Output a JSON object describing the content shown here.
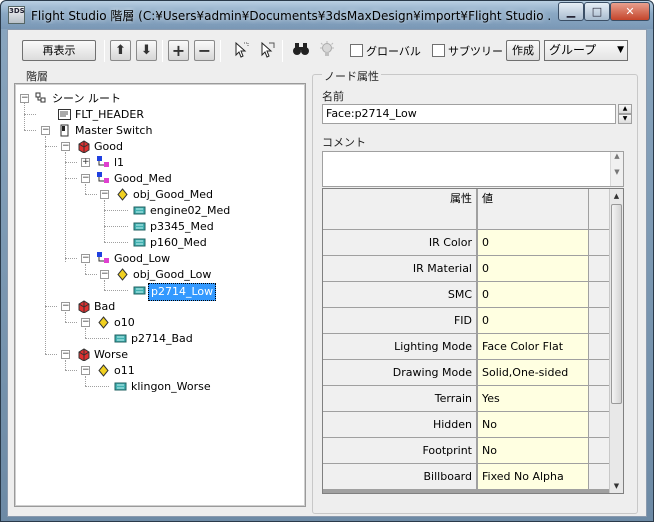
{
  "window": {
    "title": "Flight Studio 階層 (C:¥Users¥admin¥Documents¥3dsMaxDesign¥import¥Flight Studio ...",
    "app_icon_text": "3DS",
    "minimize_glyph": "▁",
    "maximize_glyph": "□",
    "close_glyph": "✕"
  },
  "toolbar": {
    "refresh_label": "再表示",
    "global_label": "グローバル",
    "subtree_label": "サブツリー",
    "create_label": "作成",
    "group_select": "グループ",
    "icons": [
      "arrow-up-icon",
      "arrow-down-icon",
      "plus-icon",
      "minus-icon",
      "select-cursor-icon",
      "select-cursor-alt-icon",
      "binoculars-icon",
      "lightbulb-icon"
    ]
  },
  "hierarchy": {
    "label": "階層",
    "nodes": [
      {
        "label": "シーン ルート",
        "icon": "scene-root-icon",
        "level": 0,
        "expander": "−"
      },
      {
        "label": "FLT_HEADER",
        "icon": "header-icon",
        "level": 1,
        "expander": ""
      },
      {
        "label": "Master Switch",
        "icon": "switch-icon",
        "level": 1,
        "expander": "−"
      },
      {
        "label": "Good",
        "icon": "lod-icon",
        "level": 2,
        "expander": "−"
      },
      {
        "label": "l1",
        "icon": "group-icon",
        "level": 3,
        "expander": "+"
      },
      {
        "label": "Good_Med",
        "icon": "group-icon",
        "level": 3,
        "expander": "−"
      },
      {
        "label": "obj_Good_Med",
        "icon": "object-icon",
        "level": 4,
        "expander": "−"
      },
      {
        "label": "engine02_Med",
        "icon": "face-icon",
        "level": 5,
        "expander": ""
      },
      {
        "label": "p3345_Med",
        "icon": "face-icon",
        "level": 5,
        "expander": ""
      },
      {
        "label": "p160_Med",
        "icon": "face-icon",
        "level": 5,
        "expander": ""
      },
      {
        "label": "Good_Low",
        "icon": "group-icon",
        "level": 3,
        "expander": "−"
      },
      {
        "label": "obj_Good_Low",
        "icon": "object-icon",
        "level": 4,
        "expander": "−"
      },
      {
        "label": "p2714_Low",
        "icon": "face-icon",
        "level": 5,
        "expander": "",
        "selected": true
      },
      {
        "label": "Bad",
        "icon": "lod-icon",
        "level": 2,
        "expander": "−"
      },
      {
        "label": "o10",
        "icon": "object-icon",
        "level": 3,
        "expander": "−"
      },
      {
        "label": "p2714_Bad",
        "icon": "face-icon",
        "level": 4,
        "expander": ""
      },
      {
        "label": "Worse",
        "icon": "lod-icon",
        "level": 2,
        "expander": "−"
      },
      {
        "label": "o11",
        "icon": "object-icon",
        "level": 3,
        "expander": "−"
      },
      {
        "label": "klingon_Worse",
        "icon": "face-icon",
        "level": 4,
        "expander": ""
      }
    ]
  },
  "node_attributes": {
    "group_label": "ノード属性",
    "name_label": "名前",
    "name_value": "Face:p2714_Low",
    "comment_label": "コメント",
    "comment_value": "",
    "columns": {
      "attribute": "属性",
      "value": "値"
    },
    "rows": [
      {
        "attribute": "IR Color",
        "value": "0"
      },
      {
        "attribute": "IR Material",
        "value": "0"
      },
      {
        "attribute": "SMC",
        "value": "0"
      },
      {
        "attribute": "FID",
        "value": "0"
      },
      {
        "attribute": "Lighting Mode",
        "value": "Face Color Flat"
      },
      {
        "attribute": "Drawing Mode",
        "value": "Solid,One-sided"
      },
      {
        "attribute": "Terrain",
        "value": "Yes"
      },
      {
        "attribute": "Hidden",
        "value": "No"
      },
      {
        "attribute": "Footprint",
        "value": "No"
      },
      {
        "attribute": "Billboard",
        "value": "Fixed No Alpha"
      }
    ]
  }
}
